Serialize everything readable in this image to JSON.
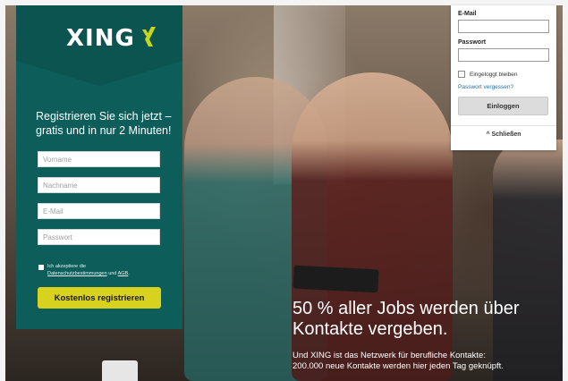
{
  "brand": {
    "logo_text": "XING",
    "accent_color": "#0d5e5a",
    "cta_color": "#d8d21f",
    "mark_color": "#c7d51d"
  },
  "registration": {
    "headline": "Registrieren Sie sich jetzt – gratis und in nur 2 Minuten!",
    "fields": {
      "first_name_placeholder": "Vorname",
      "last_name_placeholder": "Nachname",
      "email_placeholder": "E-Mail",
      "password_placeholder": "Passwort"
    },
    "agb": {
      "prefix": "Ich akzeptiere die",
      "privacy_link": "Datenschutzbestimmungen",
      "and": "und",
      "terms_link": "AGB",
      "suffix": "."
    },
    "submit_label": "Kostenlos registrieren"
  },
  "login": {
    "email_label": "E-Mail",
    "password_label": "Passwort",
    "remember_label": "Eingeloggt bleiben",
    "forgot_link": "Passwort vergessen?",
    "submit_label": "Einloggen",
    "close_label": "^ Schließen"
  },
  "hero": {
    "headline_line1": "50 % aller Jobs werden über",
    "headline_line2": "Kontakte vergeben.",
    "sub_line1": "Und XING ist das Netzwerk für berufliche Kontakte:",
    "sub_line2": "200.000 neue Kontakte werden hier jeden Tag geknüpft."
  }
}
